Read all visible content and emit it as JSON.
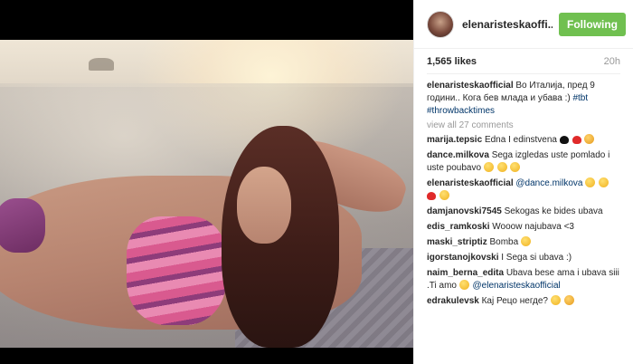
{
  "post": {
    "username": "elenaristeskaoffi...",
    "follow_label": "Following",
    "likes": "1,565 likes",
    "time_ago": "20h",
    "view_all": "view all 27 comments",
    "colors": {
      "follow_button": "#70c050",
      "hashtag": "#003569"
    }
  },
  "caption": {
    "user": "elenaristeskaofficial",
    "text": "Во Италија, пред 9 години.. Кога бев млада и убава :)",
    "hashtags": [
      "#tbt",
      "#throwbacktimes"
    ]
  },
  "comments": [
    {
      "user": "marija.tepsic",
      "text": "Edna I edinstvena",
      "emojis": [
        "heart-black",
        "heart-red",
        "cat-face"
      ]
    },
    {
      "user": "dance.milkova",
      "text": "Sega izgledas uste pomlado i uste poubavo",
      "emojis": [
        "smiley-face",
        "smiley-face",
        "smiley-face"
      ]
    },
    {
      "user": "elenaristeskaofficial",
      "mention": "@dance.milkova",
      "text": "",
      "emojis": [
        "smiley-face",
        "smiley-face",
        "heart-red",
        "smiley-face"
      ]
    },
    {
      "user": "damjanovski7545",
      "text": "Sekogas ke bides ubava",
      "emojis": []
    },
    {
      "user": "edis_ramkoski",
      "text": "Wooow najubava <3",
      "emojis": []
    },
    {
      "user": "maski_striptiz",
      "text": "Bomba",
      "emojis": [
        "smiley-face"
      ]
    },
    {
      "user": "igorstanojkovski",
      "text": "I Sega si ubava :)",
      "emojis": []
    },
    {
      "user": "naim_berna_edita",
      "text": "Ubava bese ama i ubava siii .Ti amo",
      "emojis": [
        "smiley-face"
      ],
      "mention": "@elenaristeskaofficial"
    },
    {
      "user": "edrakulevsk",
      "text": "Кај Рецо негде?",
      "emojis": [
        "smiley-face",
        "cat-face"
      ]
    }
  ]
}
